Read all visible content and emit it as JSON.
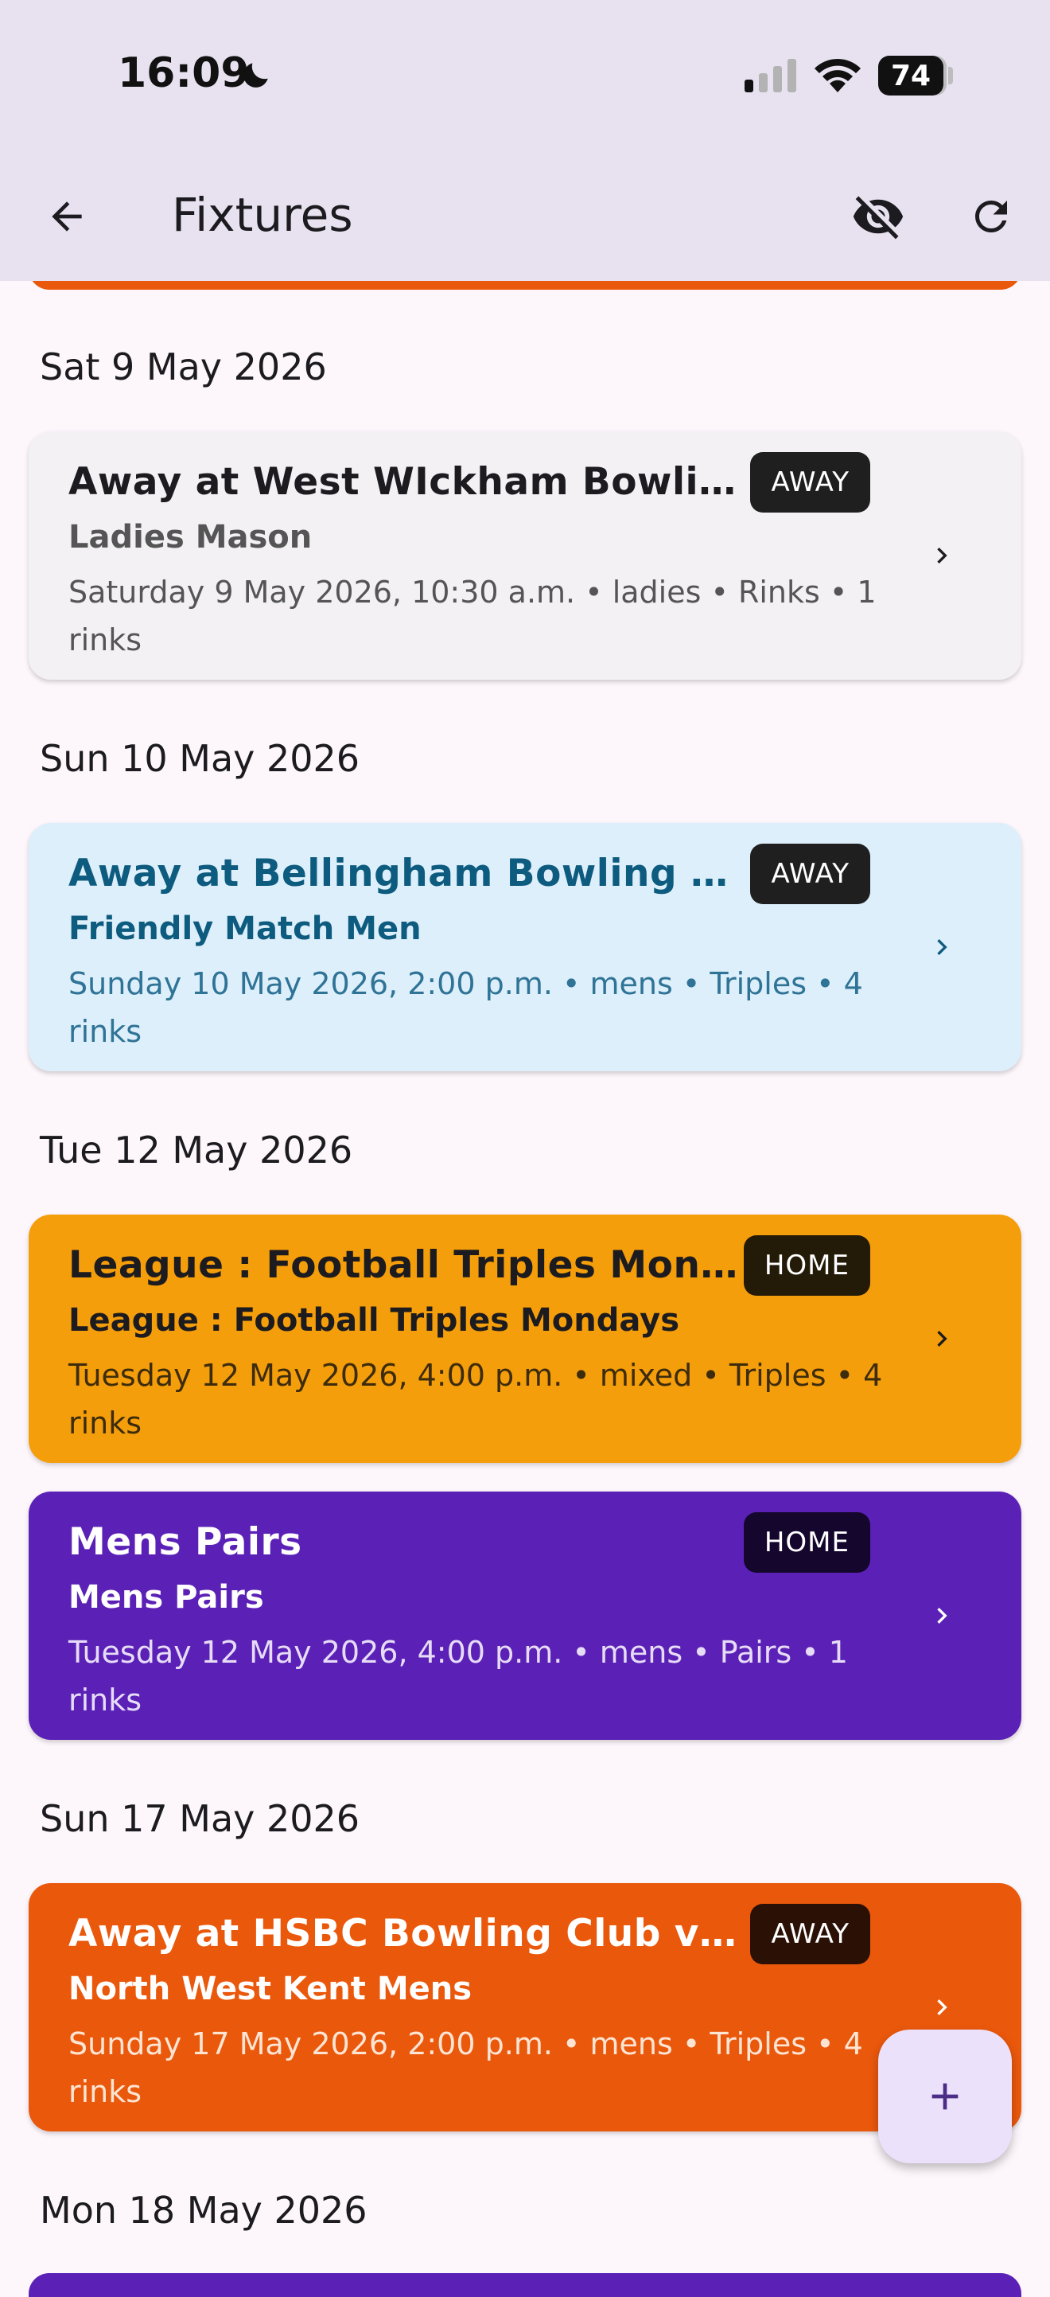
{
  "status": {
    "time": "16:09",
    "battery": "74"
  },
  "appbar": {
    "title": "Fixtures"
  },
  "colors": {
    "away_card": "#f4f1f5",
    "friendly_card": "#dceffa",
    "league_card": "#f59e0b",
    "pairs_card": "#5b21b6",
    "nwk_card": "#ea580c"
  },
  "icons": {
    "back": "arrow-left-icon",
    "visibility": "eye-off-icon",
    "refresh": "refresh-icon",
    "add": "plus-icon",
    "chevron": "chevron-right-icon"
  },
  "groups": [
    {
      "date": "Sat 9 May 2026"
    },
    {
      "date": "Sun 10 May 2026"
    },
    {
      "date": "Tue 12 May 2026"
    },
    {
      "date": "Sun 17 May 2026"
    },
    {
      "date": "Mon 18 May 2026"
    }
  ],
  "fixtures": [
    {
      "title": "Away at West WIckham Bowlin…",
      "badge": "AWAY",
      "subtitle": "Ladies Mason",
      "details": "Saturday 9 May 2026, 10:30 a.m. • ladies • Rinks • 1 rinks"
    },
    {
      "title": "Away at Bellingham Bowling Club",
      "badge": "AWAY",
      "subtitle": "Friendly Match Men",
      "details": "Sunday 10 May 2026, 2:00 p.m. • mens • Triples • 4 rinks"
    },
    {
      "title": "League : Football Triples Mond…",
      "badge": "HOME",
      "subtitle": "League : Football Triples Mondays",
      "details": "Tuesday 12 May 2026, 4:00 p.m. • mixed • Triples • 4 rinks"
    },
    {
      "title": "Mens Pairs",
      "badge": "HOME",
      "subtitle": "Mens Pairs",
      "details": "Tuesday 12 May 2026, 4:00 p.m. • mens • Pairs • 1 rinks"
    },
    {
      "title": "Away at HSBC Bowling Club v N…",
      "badge": "AWAY",
      "subtitle": "North West Kent Mens",
      "details": "Sunday 17 May 2026, 2:00 p.m. • mens • Triples • 4 rinks"
    }
  ]
}
